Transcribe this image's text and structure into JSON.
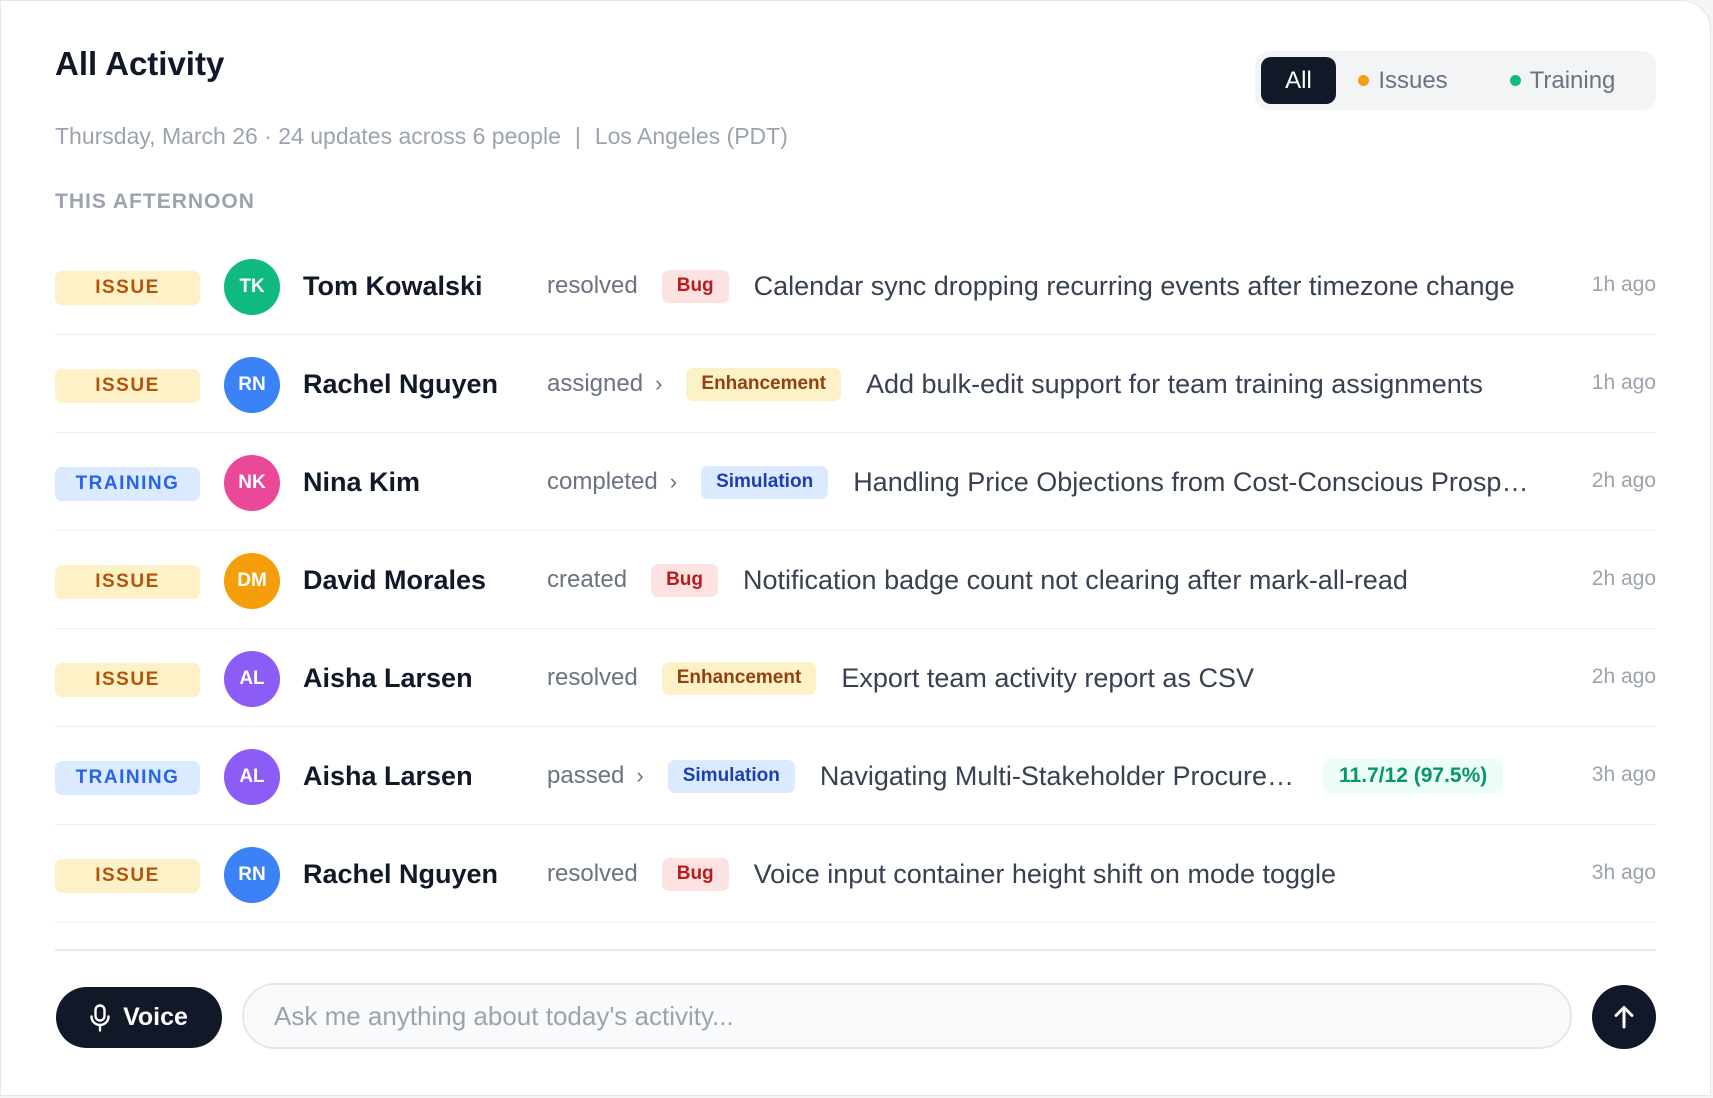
{
  "header": {
    "title": "All Activity",
    "date": "Thursday, March 26 · 24 updates across 6 people",
    "separator": "|",
    "location": "Los Angeles (PDT)"
  },
  "filters": {
    "all": "All",
    "issues": "Issues",
    "training": "Training",
    "issues_color": "#f59e0b",
    "training_color": "#10b981",
    "selected": "All"
  },
  "section": {
    "label": "THIS AFTERNOON"
  },
  "rows": [
    {
      "type": "ISSUE",
      "kind": "issue",
      "initials": "TK",
      "avatar_color": "#10b981",
      "name": "Tom Kowalski",
      "verb": "resolved",
      "chevron": "",
      "category": "Bug",
      "cat_kind": "bug",
      "description": "Calendar sync dropping recurring events after timezone change",
      "score": "",
      "time": "1h ago"
    },
    {
      "type": "ISSUE",
      "kind": "issue",
      "initials": "RN",
      "avatar_color": "#3b82f6",
      "name": "Rachel Nguyen",
      "verb": "assigned",
      "chevron": "›",
      "category": "Enhancement",
      "cat_kind": "enh",
      "description": "Add bulk-edit support for team training assignments",
      "score": "",
      "time": "1h ago"
    },
    {
      "type": "TRAINING",
      "kind": "training",
      "initials": "NK",
      "avatar_color": "#ec4899",
      "name": "Nina Kim",
      "verb": "completed",
      "chevron": "›",
      "category": "Simulation",
      "cat_kind": "sim",
      "description": "Handling Price Objections from Cost-Conscious Prosp…",
      "score": "",
      "time": "2h ago"
    },
    {
      "type": "ISSUE",
      "kind": "issue",
      "initials": "DM",
      "avatar_color": "#f59e0b",
      "name": "David Morales",
      "verb": "created",
      "chevron": "",
      "category": "Bug",
      "cat_kind": "bug",
      "description": "Notification badge count not clearing after mark-all-read",
      "score": "",
      "time": "2h ago"
    },
    {
      "type": "ISSUE",
      "kind": "issue",
      "initials": "AL",
      "avatar_color": "#8b5cf6",
      "name": "Aisha Larsen",
      "verb": "resolved",
      "chevron": "",
      "category": "Enhancement",
      "cat_kind": "enh",
      "description": "Export team activity report as CSV",
      "score": "",
      "time": "2h ago"
    },
    {
      "type": "TRAINING",
      "kind": "training",
      "initials": "AL",
      "avatar_color": "#8b5cf6",
      "name": "Aisha Larsen",
      "verb": "passed",
      "chevron": "›",
      "category": "Simulation",
      "cat_kind": "sim",
      "description": "Navigating Multi-Stakeholder Procure…",
      "score": "11.7/12 (97.5%)",
      "time": "3h ago"
    },
    {
      "type": "ISSUE",
      "kind": "issue",
      "initials": "RN",
      "avatar_color": "#3b82f6",
      "name": "Rachel Nguyen",
      "verb": "resolved",
      "chevron": "",
      "category": "Bug",
      "cat_kind": "bug",
      "description": "Voice input container height shift on mode toggle",
      "score": "",
      "time": "3h ago"
    }
  ],
  "footer": {
    "voice_label": "Voice",
    "ask_placeholder": "Ask me anything about today's activity...",
    "ask_value": "",
    "voice_icon": "microphone-icon",
    "send_icon": "arrow-up-icon"
  }
}
